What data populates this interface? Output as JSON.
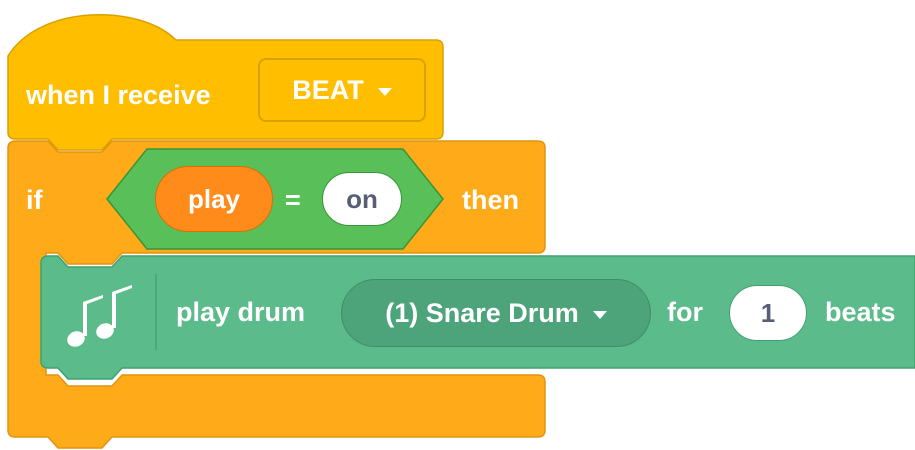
{
  "hat_block": {
    "label": "when I receive",
    "message_value": "BEAT"
  },
  "if_block": {
    "if_label": "if",
    "then_label": "then",
    "condition": {
      "left_reporter": "play",
      "operator": "=",
      "right_value": "on"
    }
  },
  "drum_block": {
    "icon": "music-notes-icon",
    "label": "play drum",
    "drum_value": "(1) Snare Drum",
    "for_label": "for",
    "beats_value": "1",
    "beats_label": "beats"
  },
  "colors": {
    "events": "#FFBF00",
    "control": "#FFAB19",
    "operators": "#59C059",
    "variables": "#FF8C1A",
    "music": "#5CBB8A"
  }
}
